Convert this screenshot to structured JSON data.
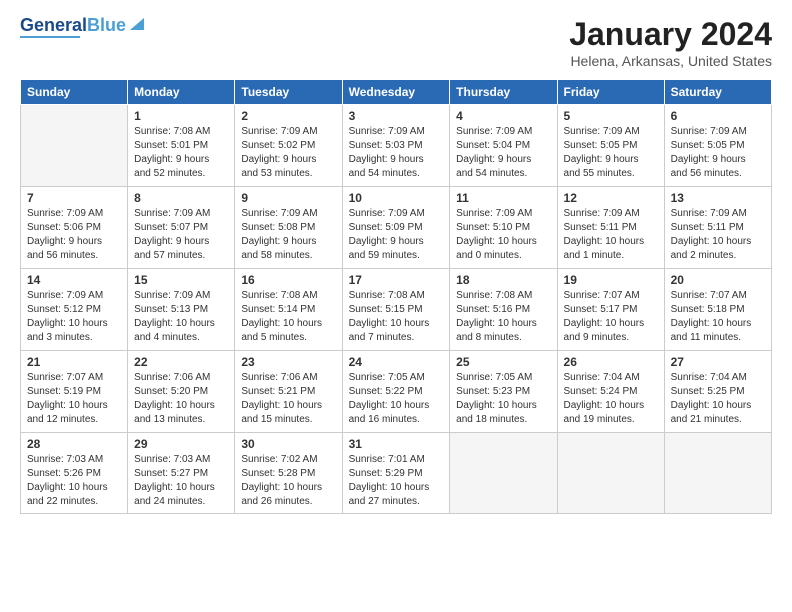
{
  "logo": {
    "part1": "General",
    "part2": "Blue"
  },
  "title": "January 2024",
  "subtitle": "Helena, Arkansas, United States",
  "headers": [
    "Sunday",
    "Monday",
    "Tuesday",
    "Wednesday",
    "Thursday",
    "Friday",
    "Saturday"
  ],
  "weeks": [
    [
      {
        "num": "",
        "lines": []
      },
      {
        "num": "1",
        "lines": [
          "Sunrise: 7:08 AM",
          "Sunset: 5:01 PM",
          "Daylight: 9 hours",
          "and 52 minutes."
        ]
      },
      {
        "num": "2",
        "lines": [
          "Sunrise: 7:09 AM",
          "Sunset: 5:02 PM",
          "Daylight: 9 hours",
          "and 53 minutes."
        ]
      },
      {
        "num": "3",
        "lines": [
          "Sunrise: 7:09 AM",
          "Sunset: 5:03 PM",
          "Daylight: 9 hours",
          "and 54 minutes."
        ]
      },
      {
        "num": "4",
        "lines": [
          "Sunrise: 7:09 AM",
          "Sunset: 5:04 PM",
          "Daylight: 9 hours",
          "and 54 minutes."
        ]
      },
      {
        "num": "5",
        "lines": [
          "Sunrise: 7:09 AM",
          "Sunset: 5:05 PM",
          "Daylight: 9 hours",
          "and 55 minutes."
        ]
      },
      {
        "num": "6",
        "lines": [
          "Sunrise: 7:09 AM",
          "Sunset: 5:05 PM",
          "Daylight: 9 hours",
          "and 56 minutes."
        ]
      }
    ],
    [
      {
        "num": "7",
        "lines": [
          "Sunrise: 7:09 AM",
          "Sunset: 5:06 PM",
          "Daylight: 9 hours",
          "and 56 minutes."
        ]
      },
      {
        "num": "8",
        "lines": [
          "Sunrise: 7:09 AM",
          "Sunset: 5:07 PM",
          "Daylight: 9 hours",
          "and 57 minutes."
        ]
      },
      {
        "num": "9",
        "lines": [
          "Sunrise: 7:09 AM",
          "Sunset: 5:08 PM",
          "Daylight: 9 hours",
          "and 58 minutes."
        ]
      },
      {
        "num": "10",
        "lines": [
          "Sunrise: 7:09 AM",
          "Sunset: 5:09 PM",
          "Daylight: 9 hours",
          "and 59 minutes."
        ]
      },
      {
        "num": "11",
        "lines": [
          "Sunrise: 7:09 AM",
          "Sunset: 5:10 PM",
          "Daylight: 10 hours",
          "and 0 minutes."
        ]
      },
      {
        "num": "12",
        "lines": [
          "Sunrise: 7:09 AM",
          "Sunset: 5:11 PM",
          "Daylight: 10 hours",
          "and 1 minute."
        ]
      },
      {
        "num": "13",
        "lines": [
          "Sunrise: 7:09 AM",
          "Sunset: 5:11 PM",
          "Daylight: 10 hours",
          "and 2 minutes."
        ]
      }
    ],
    [
      {
        "num": "14",
        "lines": [
          "Sunrise: 7:09 AM",
          "Sunset: 5:12 PM",
          "Daylight: 10 hours",
          "and 3 minutes."
        ]
      },
      {
        "num": "15",
        "lines": [
          "Sunrise: 7:09 AM",
          "Sunset: 5:13 PM",
          "Daylight: 10 hours",
          "and 4 minutes."
        ]
      },
      {
        "num": "16",
        "lines": [
          "Sunrise: 7:08 AM",
          "Sunset: 5:14 PM",
          "Daylight: 10 hours",
          "and 5 minutes."
        ]
      },
      {
        "num": "17",
        "lines": [
          "Sunrise: 7:08 AM",
          "Sunset: 5:15 PM",
          "Daylight: 10 hours",
          "and 7 minutes."
        ]
      },
      {
        "num": "18",
        "lines": [
          "Sunrise: 7:08 AM",
          "Sunset: 5:16 PM",
          "Daylight: 10 hours",
          "and 8 minutes."
        ]
      },
      {
        "num": "19",
        "lines": [
          "Sunrise: 7:07 AM",
          "Sunset: 5:17 PM",
          "Daylight: 10 hours",
          "and 9 minutes."
        ]
      },
      {
        "num": "20",
        "lines": [
          "Sunrise: 7:07 AM",
          "Sunset: 5:18 PM",
          "Daylight: 10 hours",
          "and 11 minutes."
        ]
      }
    ],
    [
      {
        "num": "21",
        "lines": [
          "Sunrise: 7:07 AM",
          "Sunset: 5:19 PM",
          "Daylight: 10 hours",
          "and 12 minutes."
        ]
      },
      {
        "num": "22",
        "lines": [
          "Sunrise: 7:06 AM",
          "Sunset: 5:20 PM",
          "Daylight: 10 hours",
          "and 13 minutes."
        ]
      },
      {
        "num": "23",
        "lines": [
          "Sunrise: 7:06 AM",
          "Sunset: 5:21 PM",
          "Daylight: 10 hours",
          "and 15 minutes."
        ]
      },
      {
        "num": "24",
        "lines": [
          "Sunrise: 7:05 AM",
          "Sunset: 5:22 PM",
          "Daylight: 10 hours",
          "and 16 minutes."
        ]
      },
      {
        "num": "25",
        "lines": [
          "Sunrise: 7:05 AM",
          "Sunset: 5:23 PM",
          "Daylight: 10 hours",
          "and 18 minutes."
        ]
      },
      {
        "num": "26",
        "lines": [
          "Sunrise: 7:04 AM",
          "Sunset: 5:24 PM",
          "Daylight: 10 hours",
          "and 19 minutes."
        ]
      },
      {
        "num": "27",
        "lines": [
          "Sunrise: 7:04 AM",
          "Sunset: 5:25 PM",
          "Daylight: 10 hours",
          "and 21 minutes."
        ]
      }
    ],
    [
      {
        "num": "28",
        "lines": [
          "Sunrise: 7:03 AM",
          "Sunset: 5:26 PM",
          "Daylight: 10 hours",
          "and 22 minutes."
        ]
      },
      {
        "num": "29",
        "lines": [
          "Sunrise: 7:03 AM",
          "Sunset: 5:27 PM",
          "Daylight: 10 hours",
          "and 24 minutes."
        ]
      },
      {
        "num": "30",
        "lines": [
          "Sunrise: 7:02 AM",
          "Sunset: 5:28 PM",
          "Daylight: 10 hours",
          "and 26 minutes."
        ]
      },
      {
        "num": "31",
        "lines": [
          "Sunrise: 7:01 AM",
          "Sunset: 5:29 PM",
          "Daylight: 10 hours",
          "and 27 minutes."
        ]
      },
      {
        "num": "",
        "lines": []
      },
      {
        "num": "",
        "lines": []
      },
      {
        "num": "",
        "lines": []
      }
    ]
  ]
}
